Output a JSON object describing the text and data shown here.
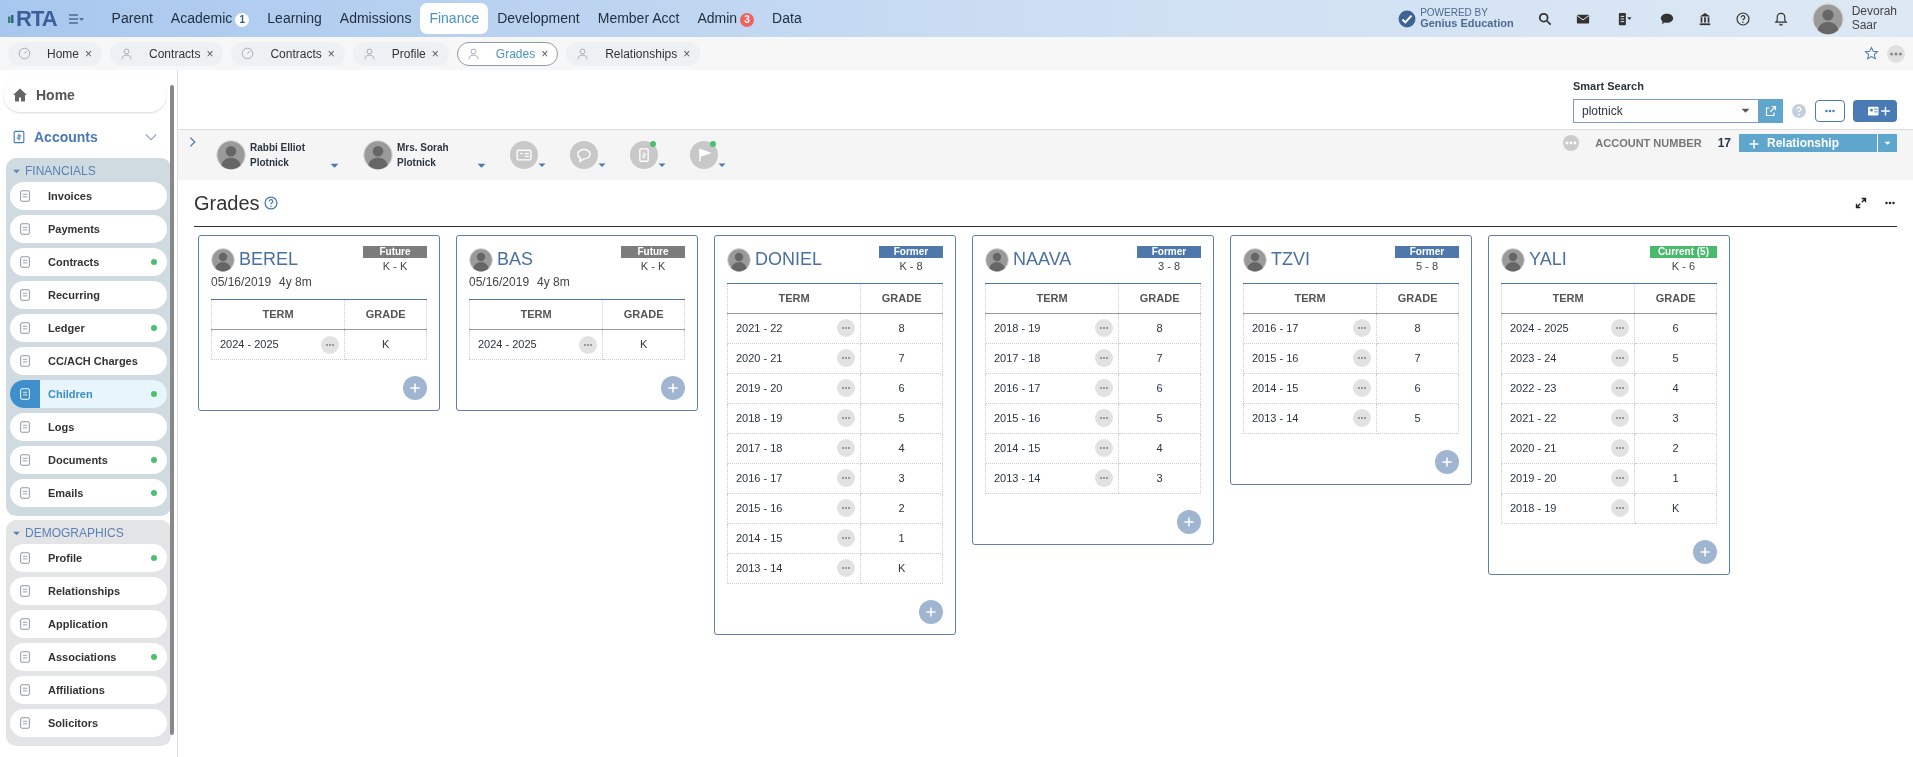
{
  "nav": {
    "logo": "RTA",
    "items": [
      {
        "label": "Parent",
        "selected": false
      },
      {
        "label": "Academic",
        "selected": false,
        "badge": "1",
        "color": "#ffffff"
      },
      {
        "label": "Learning",
        "selected": false
      },
      {
        "label": "Admissions",
        "selected": false
      },
      {
        "label": "Finance",
        "selected": true
      },
      {
        "label": "Development",
        "selected": false
      },
      {
        "label": "Member Acct",
        "selected": false
      },
      {
        "label": "Admin",
        "selected": false,
        "badge": "3",
        "color": "#f0625f"
      },
      {
        "label": "Data",
        "selected": false
      }
    ],
    "powered_by": "POWERED BY",
    "vendor": "Genius Education",
    "user": {
      "first": "Devorah",
      "last": "Saar"
    }
  },
  "tabs": [
    {
      "label": "Home",
      "kind": "gauge",
      "selected": false,
      "close": "×"
    },
    {
      "label": "Contracts",
      "kind": "person",
      "selected": false,
      "close": "×"
    },
    {
      "label": "Contracts",
      "kind": "gauge",
      "selected": false,
      "close": "×"
    },
    {
      "label": "Profile",
      "kind": "person",
      "selected": false,
      "close": "×"
    },
    {
      "label": "Grades",
      "kind": "person",
      "selected": true,
      "close": "×"
    },
    {
      "label": "Relationships",
      "kind": "person",
      "selected": false,
      "close": "×"
    }
  ],
  "sidebar": {
    "home": "Home",
    "accounts": {
      "label": "Accounts",
      "expanded": true
    },
    "groups": [
      {
        "title": "FINANCIALS",
        "expanded": true,
        "kind": "financial",
        "items": [
          {
            "label": "Invoices",
            "dot": false,
            "selected": false
          },
          {
            "label": "Payments",
            "dot": false,
            "selected": false
          },
          {
            "label": "Contracts",
            "dot": true,
            "selected": false
          },
          {
            "label": "Recurring",
            "dot": false,
            "selected": false
          },
          {
            "label": "Ledger",
            "dot": true,
            "selected": false
          },
          {
            "label": "CC/ACH Charges",
            "dot": false,
            "selected": false
          },
          {
            "label": "Children",
            "dot": true,
            "selected": true
          },
          {
            "label": "Logs",
            "dot": false,
            "selected": false
          },
          {
            "label": "Documents",
            "dot": true,
            "selected": false
          },
          {
            "label": "Emails",
            "dot": true,
            "selected": false
          }
        ]
      },
      {
        "title": "DEMOGRAPHICS",
        "expanded": true,
        "kind": "demographic",
        "items": [
          {
            "label": "Profile",
            "dot": true,
            "selected": false
          },
          {
            "label": "Relationships",
            "dot": false,
            "selected": false
          },
          {
            "label": "Application",
            "dot": false,
            "selected": false
          },
          {
            "label": "Associations",
            "dot": true,
            "selected": false
          },
          {
            "label": "Affiliations",
            "dot": false,
            "selected": false
          },
          {
            "label": "Solicitors",
            "dot": false,
            "selected": false
          }
        ]
      }
    ]
  },
  "smart_search": {
    "label": "Smart Search",
    "value": "plotnick"
  },
  "contacts": [
    {
      "name": "Rabbi Elliot Plotnick"
    },
    {
      "name": "Mrs. Sorah Plotnick"
    }
  ],
  "contact_actions": [
    {
      "kind": "card",
      "dot": false
    },
    {
      "kind": "chat",
      "dot": false
    },
    {
      "kind": "document",
      "dot": true
    },
    {
      "kind": "flag",
      "dot": true
    }
  ],
  "account": {
    "label": "ACCOUNT NUMBER",
    "number": "17",
    "button": "Relationship"
  },
  "grades": {
    "title": "Grades",
    "students": [
      {
        "name": "BEREL",
        "dob": "05/16/2019",
        "age": "4y 8m",
        "status": "Future",
        "color": "#7c7c7c",
        "range": "K - K",
        "columns": [
          "TERM",
          "GRADE"
        ],
        "rows": [
          {
            "term": "2024 - 2025",
            "grade": "K"
          }
        ]
      },
      {
        "name": "BAS",
        "dob": "05/16/2019",
        "age": "4y 8m",
        "status": "Future",
        "color": "#7c7c7c",
        "range": "K - K",
        "columns": [
          "TERM",
          "GRADE"
        ],
        "rows": [
          {
            "term": "2024 - 2025",
            "grade": "K"
          }
        ]
      },
      {
        "name": "DONIEL",
        "status": "Former",
        "color": "#4f78aa",
        "range": "K - 8",
        "columns": [
          "TERM",
          "GRADE"
        ],
        "rows": [
          {
            "term": "2021 - 22",
            "grade": "8"
          },
          {
            "term": "2020 - 21",
            "grade": "7"
          },
          {
            "term": "2019 - 20",
            "grade": "6"
          },
          {
            "term": "2018 - 19",
            "grade": "5"
          },
          {
            "term": "2017 - 18",
            "grade": "4"
          },
          {
            "term": "2016 - 17",
            "grade": "3"
          },
          {
            "term": "2015 - 16",
            "grade": "2"
          },
          {
            "term": "2014 - 15",
            "grade": "1"
          },
          {
            "term": "2013 - 14",
            "grade": "K"
          }
        ]
      },
      {
        "name": "NAAVA",
        "status": "Former",
        "color": "#4f78aa",
        "range": "3 - 8",
        "columns": [
          "TERM",
          "GRADE"
        ],
        "rows": [
          {
            "term": "2018 - 19",
            "grade": "8"
          },
          {
            "term": "2017 - 18",
            "grade": "7"
          },
          {
            "term": "2016 - 17",
            "grade": "6"
          },
          {
            "term": "2015 - 16",
            "grade": "5"
          },
          {
            "term": "2014 - 15",
            "grade": "4"
          },
          {
            "term": "2013 - 14",
            "grade": "3"
          }
        ]
      },
      {
        "name": "TZVI",
        "status": "Former",
        "color": "#4f78aa",
        "range": "5 - 8",
        "columns": [
          "TERM",
          "GRADE"
        ],
        "rows": [
          {
            "term": "2016 - 17",
            "grade": "8"
          },
          {
            "term": "2015 - 16",
            "grade": "7"
          },
          {
            "term": "2014 - 15",
            "grade": "6"
          },
          {
            "term": "2013 - 14",
            "grade": "5"
          }
        ]
      },
      {
        "name": "YALI",
        "status": "Current (5)",
        "color": "#49b96c",
        "range": "K - 6",
        "columns": [
          "TERM",
          "GRADE"
        ],
        "rows": [
          {
            "term": "2024 - 2025",
            "grade": "6"
          },
          {
            "term": "2023 - 24",
            "grade": "5"
          },
          {
            "term": "2022 - 23",
            "grade": "4"
          },
          {
            "term": "2021 - 22",
            "grade": "3"
          },
          {
            "term": "2020 - 21",
            "grade": "2"
          },
          {
            "term": "2019 - 20",
            "grade": "1"
          },
          {
            "term": "2018 - 19",
            "grade": "K"
          }
        ]
      }
    ]
  }
}
